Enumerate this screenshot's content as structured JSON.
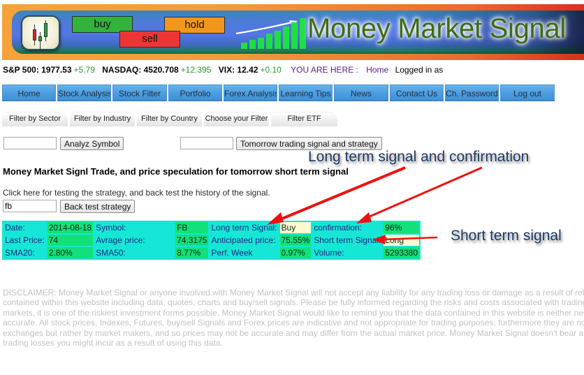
{
  "banner": {
    "title": "Money Market Signal",
    "tags": {
      "buy": "buy",
      "sell": "sell",
      "hold": "hold"
    },
    "logo_icon": "candlestick-chart-icon",
    "colors": {
      "buy": "#33b23c",
      "sell": "#ee3535",
      "hold": "#f3961b",
      "title": "#3e6b12"
    }
  },
  "ticker": {
    "sp500_label": "S&P 500:",
    "sp500_value": "1977.53",
    "sp500_change": "+5.79",
    "nasdaq_label": "NASDAQ:",
    "nasdaq_value": "4520.708",
    "nasdaq_change": "+12.395",
    "vix_label": "VIX:",
    "vix_value": "12.42",
    "vix_change": "+0.10",
    "you_are_here": "YOU ARE HERE :",
    "breadcrumb": "Home",
    "logged_in": "Logged in as"
  },
  "nav": {
    "items": [
      {
        "label": "Home"
      },
      {
        "label": "Stock Analysis"
      },
      {
        "label": "Stock Filter"
      },
      {
        "label": "Portfolio"
      },
      {
        "label": "Forex Analysis"
      },
      {
        "label": "Learning Tips"
      },
      {
        "label": "News"
      },
      {
        "label": "Contact Us"
      },
      {
        "label": "Ch. Password"
      },
      {
        "label": "Log out"
      }
    ]
  },
  "filter_tabs": {
    "items": [
      {
        "label": "Filter by Sector"
      },
      {
        "label": "Filter by Industry"
      },
      {
        "label": "Filter by Country"
      },
      {
        "label": "Choose your Filter"
      },
      {
        "label": "Filter ETF"
      }
    ]
  },
  "forms": {
    "analyze_input_value": "",
    "analyze_button": "Analyz Symbol",
    "tomorrow_input_value": "",
    "tomorrow_button": "Tomorrow trading signal and strategy",
    "backtest_input_value": "fb",
    "backtest_button": "Back test strategy"
  },
  "heading": "Money Market Signl Trade, and price speculation for tomorrow short term signal",
  "backtest_note": "Click here for testing the strategy, and back test the history of the signal.",
  "signal_table": {
    "rows": [
      [
        {
          "label": "Date:",
          "value": "2014-08-18"
        },
        {
          "label": "Symbol:",
          "value": "FB"
        },
        {
          "label": "Long term Signal:",
          "value": "Buy"
        },
        {
          "label": "confirmation:",
          "value": "96%"
        }
      ],
      [
        {
          "label": "Last Price:",
          "value": "74"
        },
        {
          "label": "Avrage price:",
          "value": "74.3175"
        },
        {
          "label": "Anticipated price:",
          "value": "75.55%"
        },
        {
          "label": "Short term Signal:",
          "value": "Long"
        }
      ],
      [
        {
          "label": "SMA20:",
          "value": "2.80%"
        },
        {
          "label": "SMA50:",
          "value": "8.77%"
        },
        {
          "label": "Perf. Week",
          "value": "0.97%"
        },
        {
          "label": "Volume:",
          "value": "5293380"
        }
      ]
    ]
  },
  "annotations": {
    "long_term": "Long term signal and confirmation",
    "short_term": "Short term signal",
    "arrow_color": "#ee1111"
  },
  "disclaimer": {
    "lines": [
      "DISCLAIMER: Money Market Signal or anyone involved with Money Market Signal will not accept any liability for any trading loss or damage as a result of reliance on the information",
      "contained within this website including data, quotes, charts and buy/sell signals. Please be fully informed regarding the risks and costs associated with trading the financial",
      "markets, it is one of the riskiest investment forms possible. Money Market Signal would like to remind you that the data contained in this website is neither necessarily real-time nor",
      "accurate. All stock prices, Indexes, Futures, buy/sell Signals and Forex prices are indicative and not appropriate for trading purposes; furthermore they are not provided by any",
      "exchanges but rather by market makers, and so prices may not be accurate and may differ from the actual market price. Money Market Signal doesn't bear any responsibility for any",
      "trading losses you might incur as a result of using this data."
    ]
  }
}
